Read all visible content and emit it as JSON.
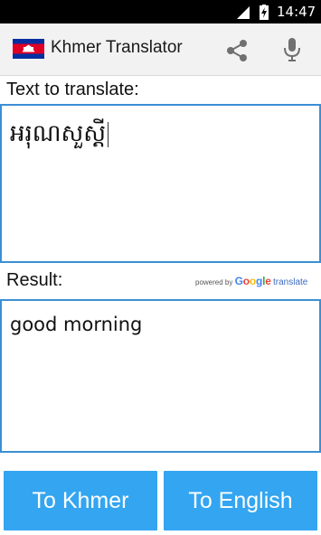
{
  "status_bar": {
    "time": "14:47"
  },
  "action_bar": {
    "title": "Khmer Translator",
    "flag_icon": "cambodia-flag",
    "share_icon": "share-icon",
    "mic_icon": "microphone-icon"
  },
  "source": {
    "label": "Text to translate:",
    "value": "អរុណសួស្តី"
  },
  "result": {
    "label": "Result:",
    "value": "good morning",
    "powered_prefix": "powered by",
    "powered_google": "Google",
    "powered_suffix": "translate"
  },
  "buttons": {
    "to_khmer": "To Khmer",
    "to_english": "To English"
  },
  "colors": {
    "accent": "#33a5f1",
    "border": "#3b8fd6",
    "actionbar_bg": "#f2f2f2"
  }
}
